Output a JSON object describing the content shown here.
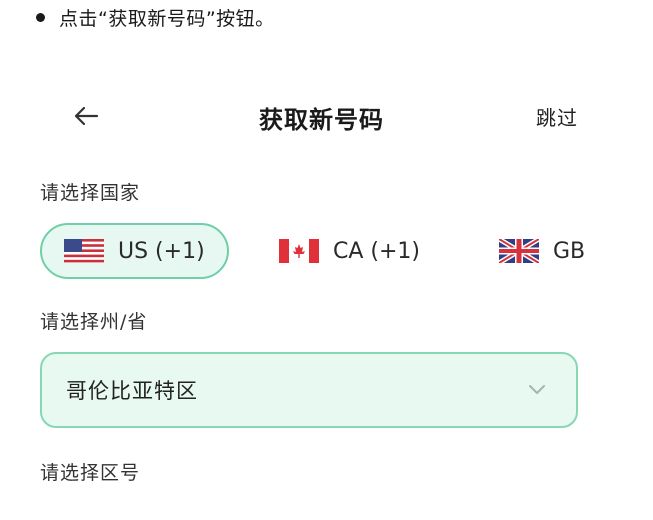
{
  "instruction": "点击“获取新号码”按钮。",
  "header": {
    "title": "获取新号码",
    "skip_label": "跳过"
  },
  "country_section": {
    "label": "请选择国家",
    "countries": [
      {
        "code": "US (+1)",
        "selected": true
      },
      {
        "code": "CA (+1)",
        "selected": false
      },
      {
        "code": "GB",
        "selected": false
      }
    ]
  },
  "state_section": {
    "label": "请选择州/省",
    "selected_value": "哥伦比亚特区"
  },
  "area_code_section": {
    "label": "请选择区号"
  },
  "colors": {
    "accent_border": "#6fcfa6",
    "accent_fill": "#e6f8f1"
  }
}
